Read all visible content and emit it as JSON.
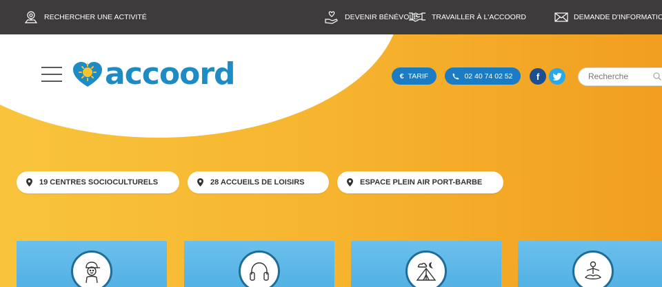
{
  "topbar": {
    "search_activity": "RECHERCHER UNE ACTIVITÉ",
    "volunteer": "DEVENIR BÉNÉVOLE",
    "work": "TRAVAILLER À L'ACCOORD",
    "info": "DEMANDE D'INFORMATION"
  },
  "header": {
    "logo_text": "accoord",
    "tarif_label": "TARIF",
    "tarif_symbol": "€",
    "phone_label": "02 40 74 02 52",
    "search_placeholder": "Recherche",
    "social": {
      "facebook": "f",
      "twitter": "twitter-bird-icon"
    }
  },
  "chips": [
    {
      "label": "19 CENTRES SOCIOCULTURELS"
    },
    {
      "label": "28 ACCUEILS DE LOISIRS"
    },
    {
      "label": "ESPACE PLEIN AIR PORT-BARBE"
    }
  ],
  "cards": [
    {
      "icon": "child-icon"
    },
    {
      "icon": "headphones-icon"
    },
    {
      "icon": "tent-icon"
    },
    {
      "icon": "yoga-icon"
    }
  ],
  "colors": {
    "topbar": "#3d3b3b",
    "brand_blue": "#1b7cc3",
    "background_orange": "#f6b42f",
    "card_blue": "#5ab6e8"
  }
}
